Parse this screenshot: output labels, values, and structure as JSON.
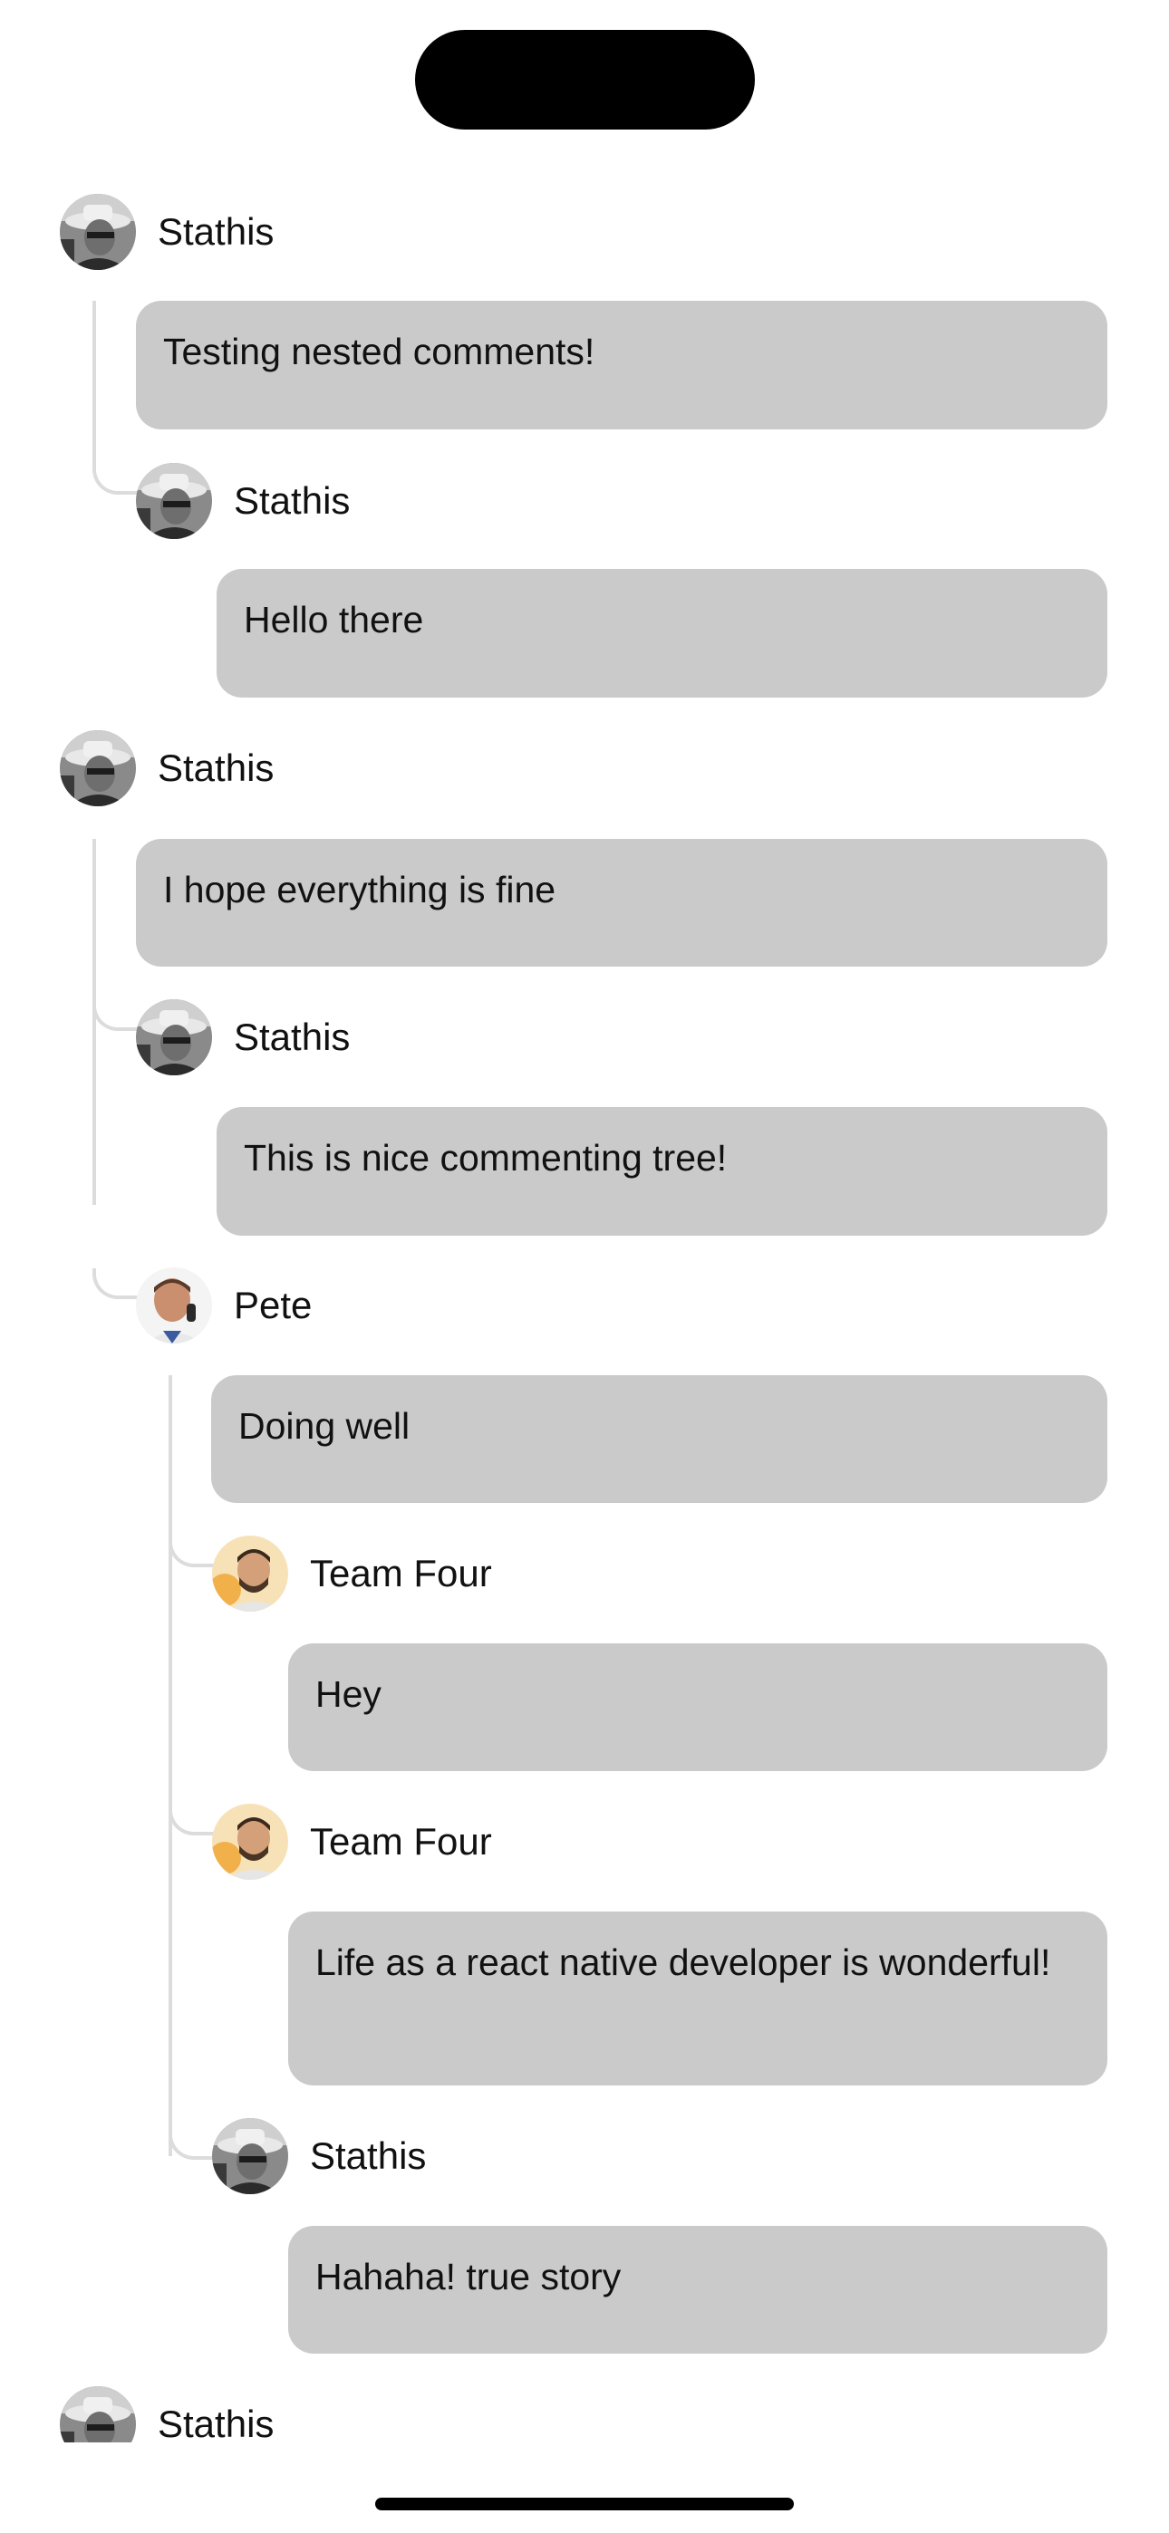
{
  "comments": [
    {
      "id": "c1",
      "user": "Stathis",
      "avatar": "stathis",
      "text": "Testing nested comments!"
    },
    {
      "id": "c1r1",
      "user": "Stathis",
      "avatar": "stathis",
      "text": "Hello there"
    },
    {
      "id": "c2",
      "user": "Stathis",
      "avatar": "stathis",
      "text": "I hope everything is fine"
    },
    {
      "id": "c2r1",
      "user": "Stathis",
      "avatar": "stathis",
      "text": "This is nice commenting tree!"
    },
    {
      "id": "c2r2",
      "user": "Pete",
      "avatar": "pete",
      "text": "Doing well"
    },
    {
      "id": "c2r2r1",
      "user": "Team Four",
      "avatar": "teamfour",
      "text": "Hey"
    },
    {
      "id": "c2r2r2",
      "user": "Team Four",
      "avatar": "teamfour",
      "text": "Life as a react native developer is wonderful!"
    },
    {
      "id": "c2r2r3",
      "user": "Stathis",
      "avatar": "stathis",
      "text": "Hahaha! true story"
    },
    {
      "id": "c3",
      "user": "Stathis",
      "avatar": "stathis",
      "text": ""
    }
  ],
  "colors": {
    "bubble": "#cacaca",
    "thread_line": "#dcdcdc",
    "background": "#ffffff"
  }
}
